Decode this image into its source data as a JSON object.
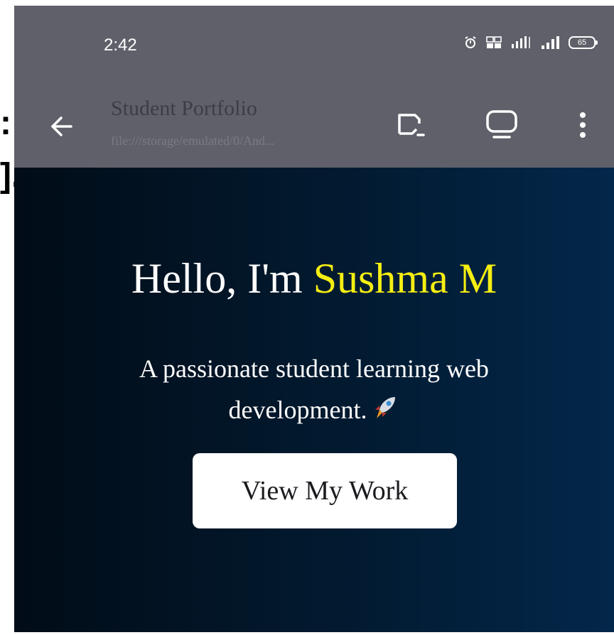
{
  "status_bar": {
    "time": "2:42",
    "battery_level": "65",
    "icons": [
      "alarm-icon",
      "volte-icon",
      "data-4g-signal-icon",
      "cell-signal-icon",
      "battery-icon"
    ]
  },
  "toolbar": {
    "title": "Student Portfolio",
    "url": "file:///storage/emulated/0/And...",
    "icons": [
      "back-arrow-icon",
      "cast-icon",
      "desktop-icon",
      "more-vert-icon"
    ]
  },
  "hero": {
    "greeting": "Hello, I'm ",
    "name": "Sushma M",
    "tagline": "A passionate student learning web development.",
    "cta_label": "View My Work"
  },
  "colors": {
    "chrome": "#5f6069",
    "hero_bg_start": "#010c17",
    "hero_bg_end": "#03274a",
    "accent_name": "#f5ee12"
  }
}
